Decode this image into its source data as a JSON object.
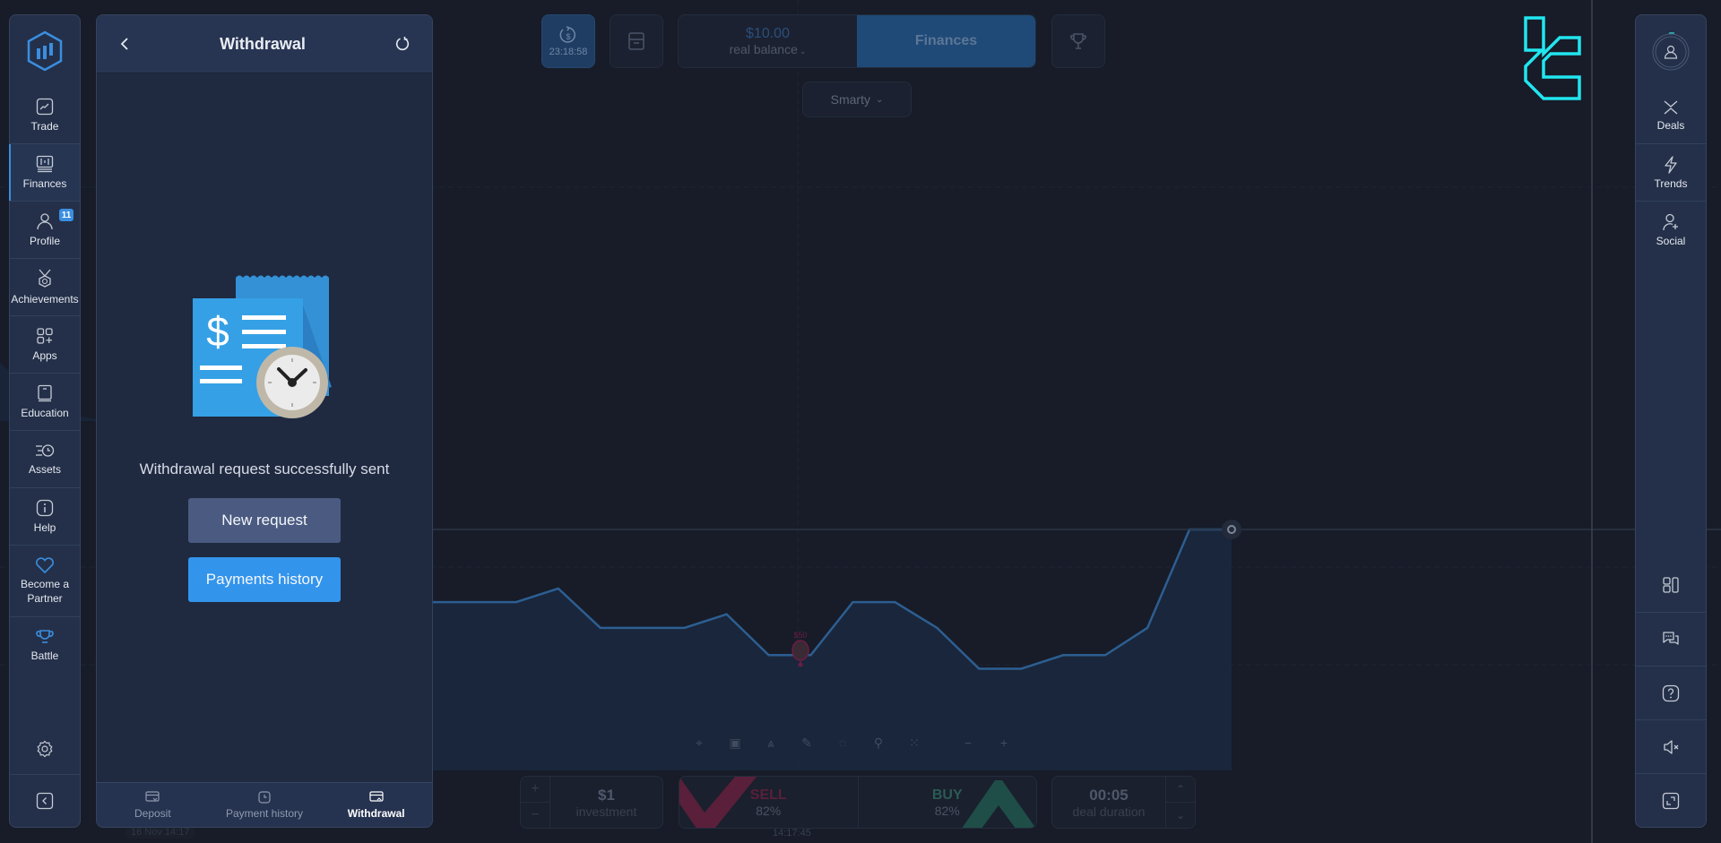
{
  "top_bar": {
    "timer": "23:18:58",
    "balance_amount": "$10.00",
    "balance_label": "real balance",
    "finances_label": "Finances",
    "strategy_select": "Smarty"
  },
  "left_sidebar": {
    "items": [
      {
        "label": "Trade",
        "icon": "chart-line-icon"
      },
      {
        "label": "Finances",
        "icon": "finances-icon",
        "active": true
      },
      {
        "label": "Profile",
        "icon": "user-icon",
        "badge": "11"
      },
      {
        "label": "Achievements",
        "icon": "medal-icon"
      },
      {
        "label": "Apps",
        "icon": "apps-icon"
      },
      {
        "label": "Education",
        "icon": "book-icon"
      },
      {
        "label": "Assets",
        "icon": "assets-icon"
      },
      {
        "label": "Help",
        "icon": "info-icon"
      },
      {
        "label": "Become a Partner",
        "icon": "heart-icon"
      },
      {
        "label": "Battle",
        "icon": "trophy-icon"
      }
    ]
  },
  "panel": {
    "title": "Withdrawal",
    "message": "Withdrawal request successfully sent",
    "new_request": "New request",
    "payments_history": "Payments history",
    "tabs": [
      {
        "label": "Deposit"
      },
      {
        "label": "Payment history"
      },
      {
        "label": "Withdrawal",
        "active": true
      }
    ]
  },
  "right_sidebar": {
    "items": [
      {
        "label": "Deals"
      },
      {
        "label": "Trends"
      },
      {
        "label": "Social"
      }
    ]
  },
  "trade_controls": {
    "investment_value": "$1",
    "investment_label": "investment",
    "sell_label": "SELL",
    "sell_pct": "82%",
    "buy_label": "BUY",
    "buy_pct": "82%",
    "duration_value": "00:05",
    "duration_label": "deal duration",
    "plus": "+",
    "minus": "−",
    "time_marker": "14:17:45",
    "date_marker": "16 Nov 14:17"
  },
  "chart": {
    "trade_marker_label": "$50",
    "series_relative": [
      0.52,
      0.52,
      0.52,
      0.61,
      0.35,
      0.35,
      0.35,
      0.44,
      0.17,
      0.17,
      0.52,
      0.52,
      0.35,
      0.08,
      0.08,
      0.17,
      0.17,
      0.35,
      1.0,
      1.0
    ],
    "colors": {
      "line": "#2d5e91",
      "accent": "#3a8ee0"
    }
  }
}
